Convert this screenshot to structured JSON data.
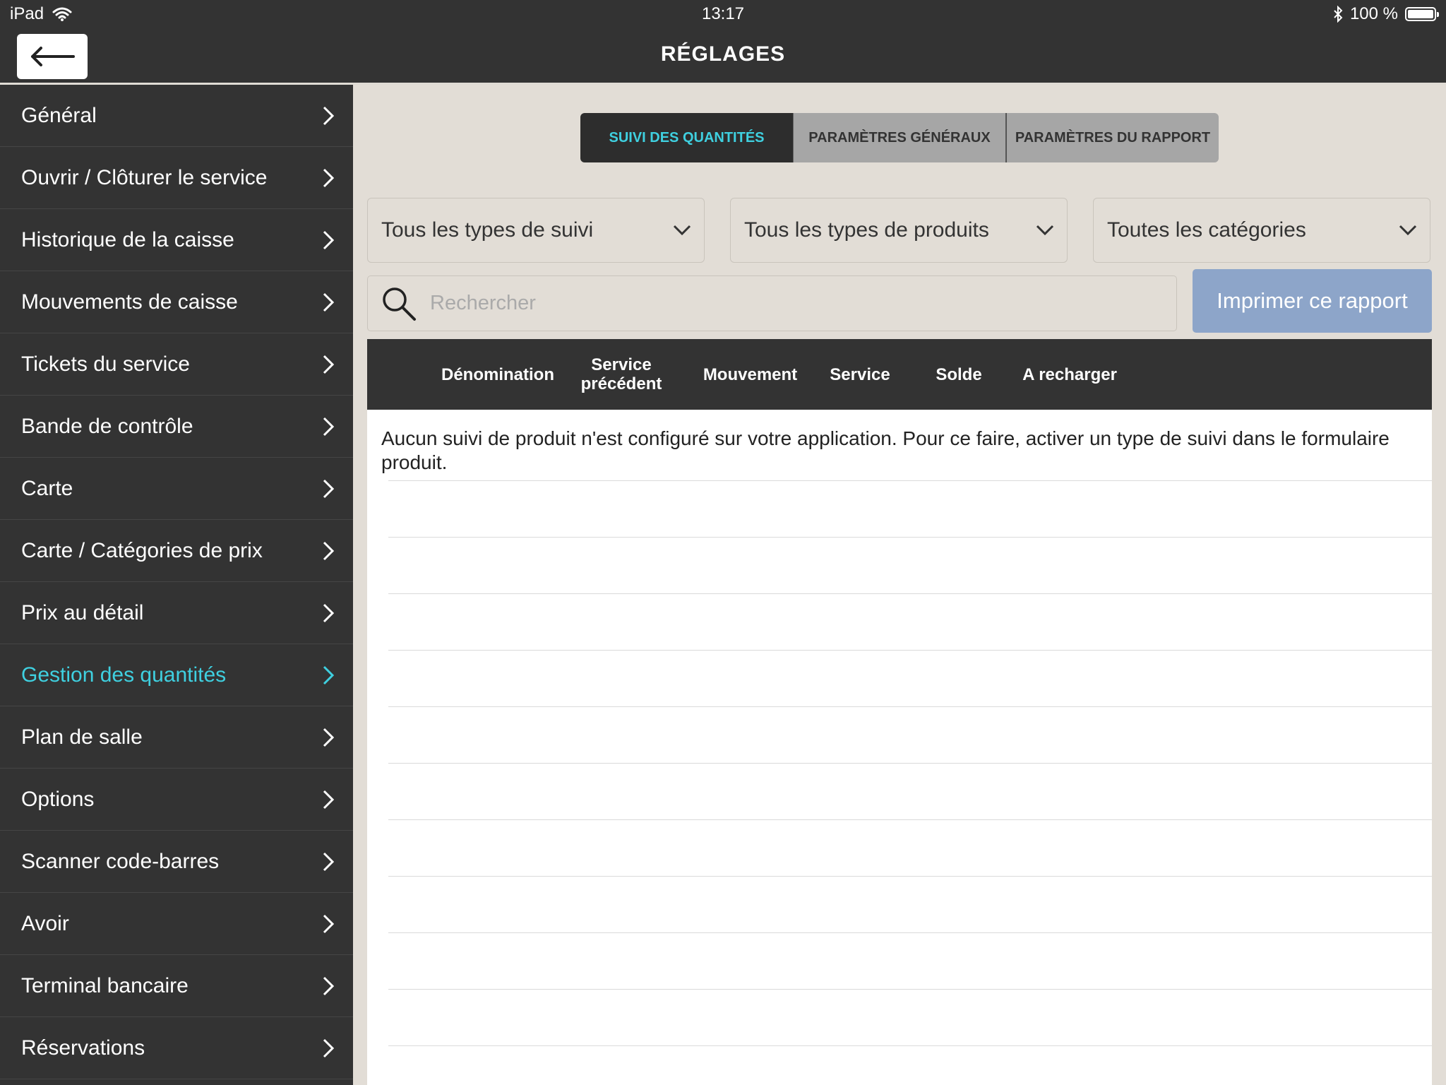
{
  "status": {
    "device": "iPad",
    "time": "13:17",
    "battery": "100 %",
    "battery_level": 1.0
  },
  "header": {
    "title": "RÉGLAGES"
  },
  "sidebar": {
    "items": [
      {
        "label": "Général"
      },
      {
        "label": "Ouvrir / Clôturer le service"
      },
      {
        "label": "Historique de la caisse"
      },
      {
        "label": "Mouvements de caisse"
      },
      {
        "label": "Tickets du service"
      },
      {
        "label": "Bande de contrôle"
      },
      {
        "label": "Carte"
      },
      {
        "label": "Carte / Catégories de prix"
      },
      {
        "label": "Prix au détail"
      },
      {
        "label": "Gestion des quantités",
        "active": true
      },
      {
        "label": "Plan de salle"
      },
      {
        "label": "Options"
      },
      {
        "label": "Scanner code-barres"
      },
      {
        "label": "Avoir"
      },
      {
        "label": "Terminal bancaire"
      },
      {
        "label": "Réservations"
      }
    ]
  },
  "tabs": [
    {
      "label": "SUIVI DES QUANTITÉS",
      "active": true
    },
    {
      "label": "PARAMÈTRES GÉNÉRAUX"
    },
    {
      "label": "PARAMÈTRES DU RAPPORT"
    }
  ],
  "filters": {
    "tracking_type": "Tous les types de suivi",
    "product_type": "Tous les types de produits",
    "category": "Toutes les catégories"
  },
  "search": {
    "placeholder": "Rechercher",
    "value": ""
  },
  "print_button": "Imprimer ce rapport",
  "table": {
    "columns": [
      "Dénomination",
      "Service\nprécédent",
      "Mouvement",
      "Service",
      "Solde",
      "A recharger"
    ],
    "empty_message": "Aucun suivi de produit n'est configuré sur votre application. Pour ce faire, activer un type de suivi dans le formulaire produit."
  },
  "colors": {
    "accent": "#3fd0e0",
    "dark": "#333333",
    "panel": "#e2ddd6",
    "print_button": "#8da5c9"
  }
}
